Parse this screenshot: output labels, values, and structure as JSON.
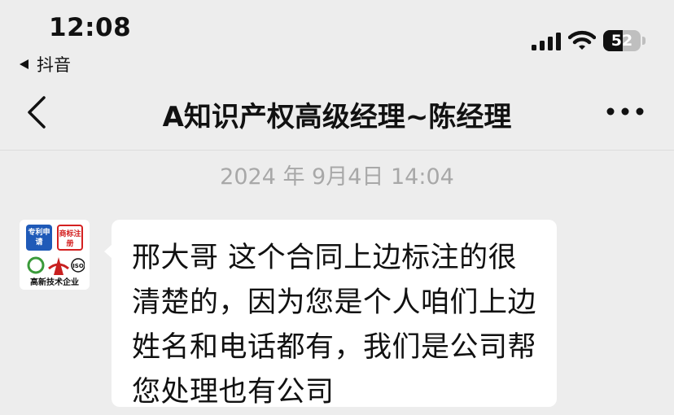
{
  "status_bar": {
    "time": "12:08",
    "back_app_label": "抖音",
    "battery_level": "52",
    "battery_fraction": 0.52,
    "icons": [
      "signal-icon",
      "wifi-icon",
      "battery-icon"
    ]
  },
  "header": {
    "title": "A知识产权高级经理~陈经理",
    "icons": [
      "chevron-left-icon",
      "more-icon"
    ]
  },
  "chat": {
    "timestamp": "2024 年 9月4日 14:04",
    "avatar": {
      "tile_a": "专利申请",
      "tile_b": "商标注册",
      "iso": "ISO",
      "caption": "高新技术企业"
    },
    "message": {
      "text": "邢大哥 这个合同上边标注的很清楚的，因为您是个人咱们上边姓名和电话都有，我们是公司帮您处理也有公司"
    }
  },
  "colors": {
    "background": "#ededed",
    "bubble": "#ffffff",
    "timestamp_text": "#a8a8a8"
  }
}
